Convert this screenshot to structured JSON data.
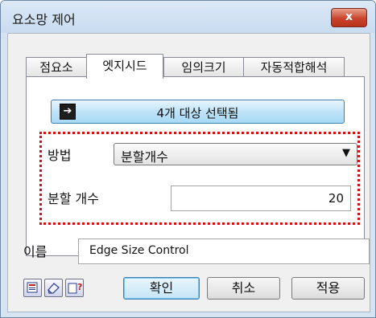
{
  "window": {
    "title": "요소망 제어",
    "close_label": "x"
  },
  "tabs": [
    {
      "label": "점요소",
      "active": false
    },
    {
      "label": "엣지시드",
      "active": true
    },
    {
      "label": "임의크기",
      "active": false
    },
    {
      "label": "자동적합해석",
      "active": false
    }
  ],
  "select_button": {
    "label": "4개 대상 선택됨",
    "icon": "arrow-right-icon"
  },
  "method": {
    "label": "방법",
    "value": "분할개수",
    "dropdown_icon": "chevron-down-icon"
  },
  "division_count": {
    "label": "분할 개수",
    "value": "20"
  },
  "name": {
    "label": "이름",
    "value": "Edge Size Control"
  },
  "footer": {
    "icons": [
      "document-icon",
      "eraser-icon",
      "help-icon"
    ],
    "ok_label": "확인",
    "cancel_label": "취소",
    "apply_label": "적용"
  },
  "colors": {
    "highlight_dotted_border": "#d4111b",
    "close_button": "#c8452c"
  }
}
